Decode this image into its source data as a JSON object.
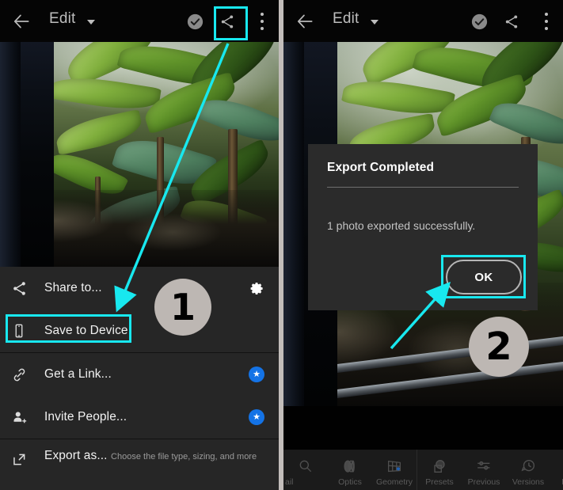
{
  "accent_color": "#18e8ef",
  "badge_color": "#1473e6",
  "panels": {
    "left": {
      "name": "Lightroom Edit screen with Share menu open",
      "topbar": {
        "back_icon": "arrow-left-icon",
        "title": "Edit",
        "caret_icon": "chevron-down-icon",
        "check_icon": "check-circle-icon",
        "share_icon": "share-icon",
        "more_icon": "more-vertical-icon"
      },
      "share_sheet": {
        "sections": [
          {
            "items": [
              {
                "icon": "share-icon",
                "label": "Share to...",
                "trailing": "gear-icon"
              },
              {
                "icon": "phone-icon",
                "label": "Save to Device",
                "highlighted": true
              }
            ]
          },
          {
            "items": [
              {
                "icon": "link-icon",
                "label": "Get a Link...",
                "trailing": "premium-star-badge"
              },
              {
                "icon": "person-add-icon",
                "label": "Invite People...",
                "trailing": "premium-star-badge"
              }
            ]
          },
          {
            "items": [
              {
                "icon": "export-icon",
                "label": "Export as...",
                "sublabel": "Choose the file type, sizing, and more"
              }
            ]
          }
        ]
      },
      "step_badge": "1"
    },
    "right": {
      "name": "Lightroom Edit screen with Export Completed dialog",
      "topbar": {
        "back_icon": "arrow-left-icon",
        "title": "Edit",
        "caret_icon": "chevron-down-icon",
        "check_icon": "check-circle-icon",
        "share_icon": "share-icon",
        "more_icon": "more-vertical-icon"
      },
      "dialog": {
        "title": "Export Completed",
        "message": "1 photo exported successfully.",
        "ok_label": "OK",
        "ok_highlighted": true
      },
      "edit_toolbar": {
        "groups": [
          [
            {
              "icon": "detail-icon",
              "label": "ail",
              "clipped": true
            },
            {
              "icon": "optics-icon",
              "label": "Optics"
            },
            {
              "icon": "geometry-icon",
              "label": "Geometry"
            }
          ],
          [
            {
              "icon": "presets-icon",
              "label": "Presets"
            },
            {
              "icon": "previous-icon",
              "label": "Previous"
            },
            {
              "icon": "versions-icon",
              "label": "Versions"
            },
            {
              "icon": "reset-icon",
              "label": "Reset"
            }
          ]
        ]
      },
      "step_badge": "2"
    }
  }
}
